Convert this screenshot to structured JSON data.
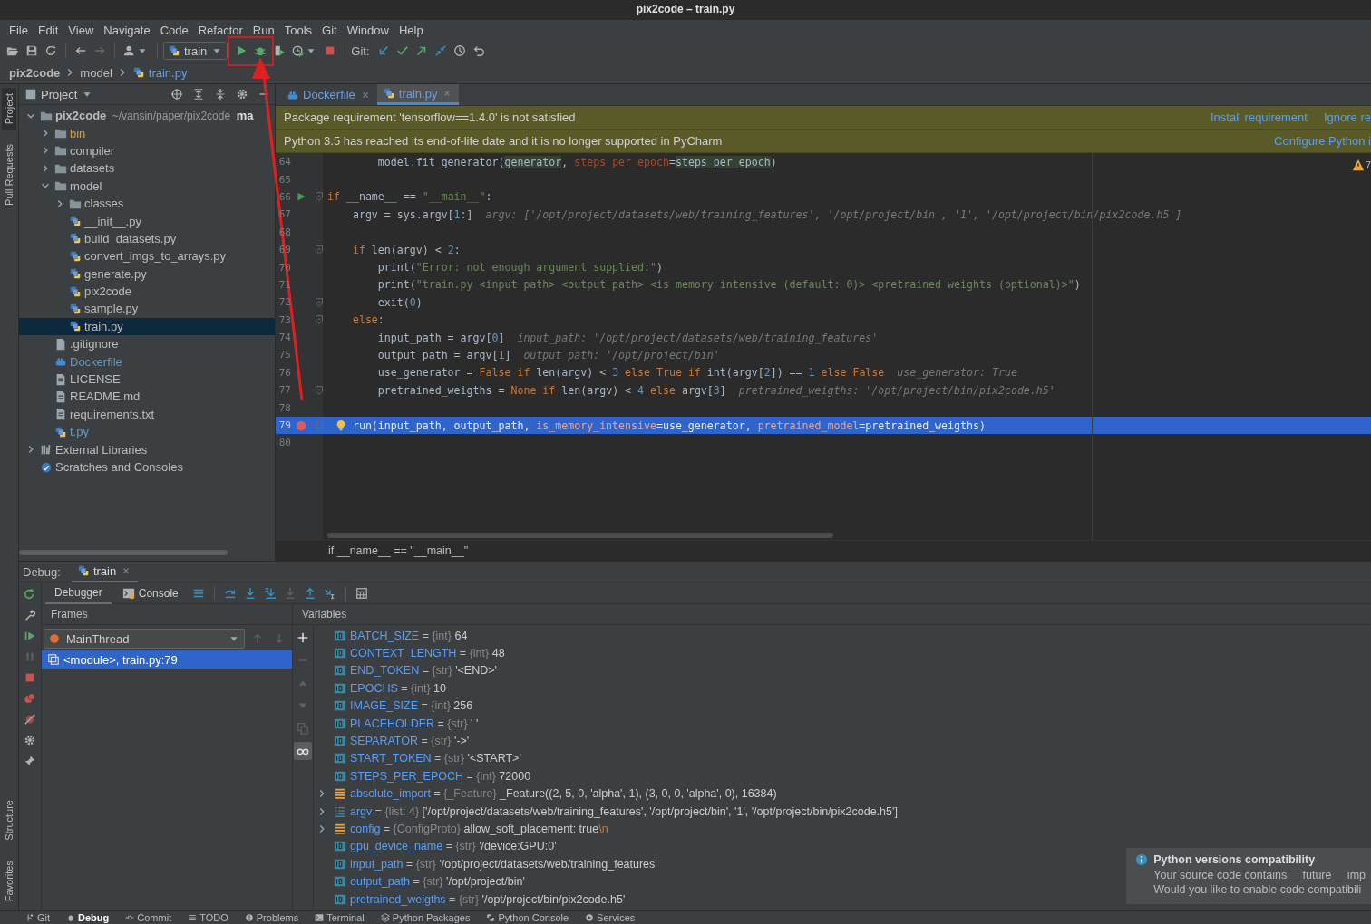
{
  "window": {
    "title": "pix2code – train.py"
  },
  "menu": [
    "File",
    "Edit",
    "View",
    "Navigate",
    "Code",
    "Refactor",
    "Run",
    "Tools",
    "Git",
    "Window",
    "Help"
  ],
  "toolbar": {
    "run_config": "train",
    "git_label": "Git:"
  },
  "breadcrumb": [
    "pix2code",
    "model",
    "train.py"
  ],
  "side_stripe": {
    "top": [
      {
        "label": "Project",
        "selected": true
      },
      {
        "label": "Pull Requests",
        "selected": false
      }
    ],
    "bottom": [
      {
        "label": "Structure",
        "selected": false
      },
      {
        "label": "Favorites",
        "selected": false
      }
    ]
  },
  "project": {
    "title": "Project",
    "tree": [
      {
        "name": "pix2code",
        "kind": "folder",
        "expanded": true,
        "selected": false,
        "color": "#bbbbbb",
        "detail": "~/vansin/paper/pix2code",
        "branch": "ma",
        "children": [
          {
            "name": "bin",
            "kind": "folder",
            "expanded": false,
            "selected": false,
            "color": "#d0a043"
          },
          {
            "name": "compiler",
            "kind": "folder",
            "expanded": false,
            "selected": false,
            "color": "#bbbbbb"
          },
          {
            "name": "datasets",
            "kind": "folder",
            "expanded": false,
            "selected": false,
            "color": "#bbbbbb"
          },
          {
            "name": "model",
            "kind": "folder",
            "expanded": true,
            "selected": false,
            "color": "#bbbbbb",
            "children": [
              {
                "name": "classes",
                "kind": "folder",
                "expanded": false,
                "selected": false,
                "color": "#bbbbbb"
              },
              {
                "name": "__init__.py",
                "kind": "py",
                "selected": false,
                "color": "#bbbbbb"
              },
              {
                "name": "build_datasets.py",
                "kind": "py",
                "selected": false,
                "color": "#bbbbbb"
              },
              {
                "name": "convert_imgs_to_arrays.py",
                "kind": "py",
                "selected": false,
                "color": "#bbbbbb"
              },
              {
                "name": "generate.py",
                "kind": "py",
                "selected": false,
                "color": "#bbbbbb"
              },
              {
                "name": "pix2code",
                "kind": "py",
                "selected": false,
                "color": "#bbbbbb"
              },
              {
                "name": "sample.py",
                "kind": "py",
                "selected": false,
                "color": "#bbbbbb"
              },
              {
                "name": "train.py",
                "kind": "py",
                "selected": true,
                "color": "#bbbbbb"
              }
            ]
          },
          {
            "name": ".gitignore",
            "kind": "file",
            "selected": false,
            "color": "#bbbbbb"
          },
          {
            "name": "Dockerfile",
            "kind": "docker",
            "selected": false,
            "color": "#6897bb"
          },
          {
            "name": "LICENSE",
            "kind": "text",
            "selected": false,
            "color": "#bbbbbb"
          },
          {
            "name": "README.md",
            "kind": "text",
            "selected": false,
            "color": "#bbbbbb"
          },
          {
            "name": "requirements.txt",
            "kind": "text",
            "selected": false,
            "color": "#bbbbbb"
          },
          {
            "name": "t.py",
            "kind": "py",
            "selected": false,
            "color": "#6897bb"
          }
        ]
      },
      {
        "name": "External Libraries",
        "kind": "library",
        "expanded": false,
        "selected": false,
        "color": "#bbbbbb"
      },
      {
        "name": "Scratches and Consoles",
        "kind": "scratches",
        "selected": false,
        "color": "#bbbbbb"
      }
    ]
  },
  "editor": {
    "tabs": [
      {
        "label": "Dockerfile",
        "kind": "docker",
        "selected": false
      },
      {
        "label": "train.py",
        "kind": "py",
        "selected": true
      }
    ],
    "banners": [
      {
        "text": "Package requirement 'tensorflow==1.4.0' is not satisfied",
        "actions": [
          "Install requirement",
          "Ignore re"
        ]
      },
      {
        "text": "Python 3.5 has reached its end-of-life date and it is no longer supported in PyCharm",
        "actions": [
          "Configure Python i"
        ]
      }
    ],
    "warning_count": "7",
    "lines": [
      {
        "number": "64",
        "tokens": [
          {
            "kind": "plain",
            "text": "        model.fit_generator("
          },
          {
            "kind": "ref",
            "text": "generator"
          },
          {
            "kind": "plain",
            "text": ", "
          },
          {
            "kind": "param",
            "text": "steps_per_epoch"
          },
          {
            "kind": "plain",
            "text": "="
          },
          {
            "kind": "ref",
            "text": "steps_per_epoch"
          },
          {
            "kind": "plain",
            "text": ")"
          }
        ],
        "current": false
      },
      {
        "number": "65",
        "current": false
      },
      {
        "number": "66",
        "tokens": [
          {
            "kind": "kw",
            "text": "if"
          },
          {
            "kind": "plain",
            "text": " __name__ == "
          },
          {
            "kind": "str",
            "text": "\"__main__\""
          },
          {
            "kind": "plain",
            "text": ":"
          }
        ],
        "run_marker": true,
        "fold": true,
        "current": false
      },
      {
        "number": "67",
        "tokens": [
          {
            "kind": "plain",
            "text": "    argv = sys.argv["
          },
          {
            "kind": "num",
            "text": "1"
          },
          {
            "kind": "plain",
            "text": ":]"
          }
        ],
        "hint": "argv: ['/opt/project/datasets/web/training_features', '/opt/project/bin', '1', '/opt/project/bin/pix2code.h5']",
        "current": false
      },
      {
        "number": "68",
        "current": false
      },
      {
        "number": "69",
        "tokens": [
          {
            "kind": "kw",
            "text": "    if"
          },
          {
            "kind": "plain",
            "text": " len(argv) < "
          },
          {
            "kind": "num",
            "text": "2"
          },
          {
            "kind": "plain",
            "text": ":"
          }
        ],
        "fold": true,
        "current": false
      },
      {
        "number": "70",
        "tokens": [
          {
            "kind": "plain",
            "text": "        print("
          },
          {
            "kind": "str",
            "text": "\"Error: not enough argument supplied:\""
          },
          {
            "kind": "plain",
            "text": ")"
          }
        ],
        "current": false
      },
      {
        "number": "71",
        "tokens": [
          {
            "kind": "plain",
            "text": "        print("
          },
          {
            "kind": "str",
            "text": "\"train.py <input path> <output path> <is memory intensive (default: 0)> <pretrained weights (optional)>\""
          },
          {
            "kind": "plain",
            "text": ")"
          }
        ],
        "current": false
      },
      {
        "number": "72",
        "tokens": [
          {
            "kind": "plain",
            "text": "        exit("
          },
          {
            "kind": "num",
            "text": "0"
          },
          {
            "kind": "plain",
            "text": ")"
          }
        ],
        "fold": true,
        "current": false
      },
      {
        "number": "73",
        "tokens": [
          {
            "kind": "kw",
            "text": "    else"
          },
          {
            "kind": "plain",
            "text": ":"
          }
        ],
        "fold": true,
        "current": false
      },
      {
        "number": "74",
        "tokens": [
          {
            "kind": "plain",
            "text": "        input_path = argv["
          },
          {
            "kind": "num",
            "text": "0"
          },
          {
            "kind": "plain",
            "text": "]"
          }
        ],
        "hint": "input_path: '/opt/project/datasets/web/training_features'",
        "current": false
      },
      {
        "number": "75",
        "tokens": [
          {
            "kind": "plain",
            "text": "        output_path = argv["
          },
          {
            "kind": "num",
            "text": "1"
          },
          {
            "kind": "plain",
            "text": "]"
          }
        ],
        "hint": "output_path: '/opt/project/bin'",
        "current": false
      },
      {
        "number": "76",
        "tokens": [
          {
            "kind": "plain",
            "text": "        use_generator = "
          },
          {
            "kind": "kw",
            "text": "False if"
          },
          {
            "kind": "plain",
            "text": " len(argv) < "
          },
          {
            "kind": "num",
            "text": "3"
          },
          {
            "kind": "kw",
            "text": " else True if"
          },
          {
            "kind": "plain",
            "text": " int(argv["
          },
          {
            "kind": "num",
            "text": "2"
          },
          {
            "kind": "plain",
            "text": "]) == "
          },
          {
            "kind": "num",
            "text": "1"
          },
          {
            "kind": "kw",
            "text": " else False"
          }
        ],
        "hint": "use_generator: True",
        "current": false
      },
      {
        "number": "77",
        "tokens": [
          {
            "kind": "plain",
            "text": "        pretrained_weigths = "
          },
          {
            "kind": "kw",
            "text": "None if"
          },
          {
            "kind": "plain",
            "text": " len(argv) < "
          },
          {
            "kind": "num",
            "text": "4"
          },
          {
            "kind": "kw",
            "text": " else"
          },
          {
            "kind": "plain",
            "text": " argv["
          },
          {
            "kind": "num",
            "text": "3"
          },
          {
            "kind": "plain",
            "text": "]"
          }
        ],
        "hint": "pretrained_weigths: '/opt/project/bin/pix2code.h5'",
        "fold": true,
        "current": false
      },
      {
        "number": "78",
        "current": false
      },
      {
        "number": "79",
        "tokens": [
          {
            "kind": "plain",
            "text": "    run(input_path, output_path, "
          },
          {
            "kind": "param",
            "text": "is_memory_intensive"
          },
          {
            "kind": "plain",
            "text": "=use_generator, "
          },
          {
            "kind": "param",
            "text": "pretrained_model"
          },
          {
            "kind": "plain",
            "text": "=pretrained_weigths)"
          }
        ],
        "breakpoint": true,
        "intention": true,
        "fold": true,
        "current": true
      },
      {
        "number": "80",
        "current": false
      }
    ],
    "footer_breadcrumb": "if __name__ == \"__main__\""
  },
  "debug": {
    "label": "Debug:",
    "session": "train",
    "tabs": [
      {
        "label": "Debugger",
        "selected": true
      },
      {
        "label": "Console",
        "selected": false
      }
    ],
    "frames": {
      "header": "Frames",
      "thread": "MainThread",
      "items": [
        {
          "label": "<module>, train.py:79",
          "selected": true
        }
      ]
    },
    "variables": {
      "header": "Variables",
      "items": [
        {
          "name": "BATCH_SIZE",
          "eq": "=",
          "type": "{int}",
          "value": "64",
          "kind": "field",
          "expandable": false
        },
        {
          "name": "CONTEXT_LENGTH",
          "eq": "=",
          "type": "{int}",
          "value": "48",
          "kind": "field",
          "expandable": false
        },
        {
          "name": "END_TOKEN",
          "eq": "=",
          "type": "{str}",
          "value": "'<END>'",
          "kind": "field",
          "expandable": false
        },
        {
          "name": "EPOCHS",
          "eq": "=",
          "type": "{int}",
          "value": "10",
          "kind": "field",
          "expandable": false
        },
        {
          "name": "IMAGE_SIZE",
          "eq": "=",
          "type": "{int}",
          "value": "256",
          "kind": "field",
          "expandable": false
        },
        {
          "name": "PLACEHOLDER",
          "eq": "=",
          "type": "{str}",
          "value": "' '",
          "kind": "field",
          "expandable": false
        },
        {
          "name": "SEPARATOR",
          "eq": "=",
          "type": "{str}",
          "value": "'->'",
          "kind": "field",
          "expandable": false
        },
        {
          "name": "START_TOKEN",
          "eq": "=",
          "type": "{str}",
          "value": "'<START>'",
          "kind": "field",
          "expandable": false
        },
        {
          "name": "STEPS_PER_EPOCH",
          "eq": "=",
          "type": "{int}",
          "value": "72000",
          "kind": "field",
          "expandable": false
        },
        {
          "name": "absolute_import",
          "eq": "=",
          "type": "{_Feature}",
          "value": "_Feature((2, 5, 0, 'alpha', 1), (3, 0, 0, 'alpha', 0), 16384)",
          "kind": "object",
          "expandable": true
        },
        {
          "name": "argv",
          "eq": "=",
          "type": "{list: 4}",
          "value": "['/opt/project/datasets/web/training_features', '/opt/project/bin', '1', '/opt/project/bin/pix2code.h5']",
          "kind": "list",
          "expandable": true
        },
        {
          "name": "config",
          "eq": "=",
          "type": "{ConfigProto}",
          "value": "allow_soft_placement: true",
          "escape": "\\n",
          "kind": "object",
          "expandable": true
        },
        {
          "name": "gpu_device_name",
          "eq": "=",
          "type": "{str}",
          "value": "'/device:GPU:0'",
          "kind": "field",
          "expandable": false
        },
        {
          "name": "input_path",
          "eq": "=",
          "type": "{str}",
          "value": "'/opt/project/datasets/web/training_features'",
          "kind": "field",
          "expandable": false
        },
        {
          "name": "output_path",
          "eq": "=",
          "type": "{str}",
          "value": "'/opt/project/bin'",
          "kind": "field",
          "expandable": false
        },
        {
          "name": "pretrained_weigths",
          "eq": "=",
          "type": "{str}",
          "value": "'/opt/project/bin/pix2code.h5'",
          "kind": "field",
          "expandable": false
        }
      ]
    }
  },
  "tool_windows": [
    {
      "label": "Git",
      "kind": "git",
      "selected": false
    },
    {
      "label": "Debug",
      "kind": "debug",
      "selected": true
    },
    {
      "label": "Commit",
      "kind": "commit",
      "selected": false
    },
    {
      "label": "TODO",
      "kind": "todo",
      "selected": false
    },
    {
      "label": "Problems",
      "kind": "problems",
      "selected": false
    },
    {
      "label": "Terminal",
      "kind": "terminal",
      "selected": false
    },
    {
      "label": "Python Packages",
      "kind": "packages",
      "selected": false
    },
    {
      "label": "Python Console",
      "kind": "pyconsole",
      "selected": false
    },
    {
      "label": "Services",
      "kind": "services",
      "selected": false
    }
  ],
  "notification": {
    "title": "Python versions compatibility",
    "lines": [
      "Your source code contains __future__ imp",
      "Would you like to enable code compatibili"
    ]
  }
}
